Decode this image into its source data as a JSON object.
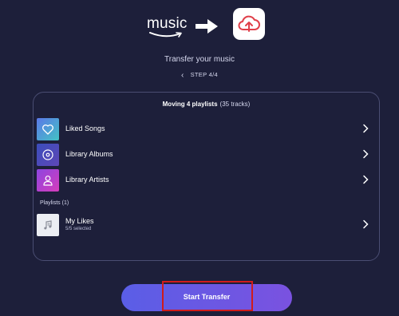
{
  "header": {
    "source_logo_text": "music",
    "source_logo_icon": "amazon-smile-logo",
    "arrow_icon": "right-arrow-icon",
    "target_icon": "cloud-upload-icon",
    "title": "Transfer your music",
    "step": "STEP 4/4"
  },
  "card": {
    "title_bold": "Moving 4 playlists",
    "title_tracks": "(35 tracks)",
    "items": [
      {
        "label": "Liked Songs",
        "icon": "heart-icon"
      },
      {
        "label": "Library Albums",
        "icon": "disc-icon"
      },
      {
        "label": "Library Artists",
        "icon": "person-icon"
      }
    ],
    "playlists_label": "Playlists (1)",
    "playlist": {
      "label": "My Likes",
      "sub": "5/5 selected",
      "icon": "music-note-icon"
    }
  },
  "action": {
    "start_label": "Start Transfer"
  },
  "colors": {
    "background": "#1d1f3a",
    "accent": "#5a5ee6",
    "highlight": "#d01b1b"
  }
}
